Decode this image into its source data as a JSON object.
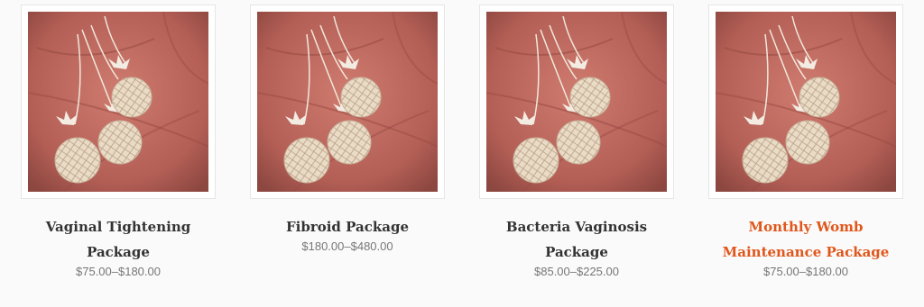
{
  "products": [
    {
      "title": "Vaginal Tightening Package",
      "price": "$75.00–$180.00",
      "image": "herbal-pearls-on-palm-image"
    },
    {
      "title": "Fibroid Package",
      "price": "$180.00–$480.00",
      "image": "herbal-pearls-on-palm-image"
    },
    {
      "title": "Bacteria Vaginosis Package",
      "price": "$85.00–$225.00",
      "image": "herbal-pearls-on-palm-image"
    },
    {
      "title": "Monthly Womb Maintenance Package",
      "price": "$75.00–$180.00",
      "image": "herbal-pearls-on-palm-image"
    }
  ],
  "colors": {
    "title": "#333333",
    "title_hover": "#e0561b",
    "price": "#777777",
    "background": "#fafafa"
  }
}
